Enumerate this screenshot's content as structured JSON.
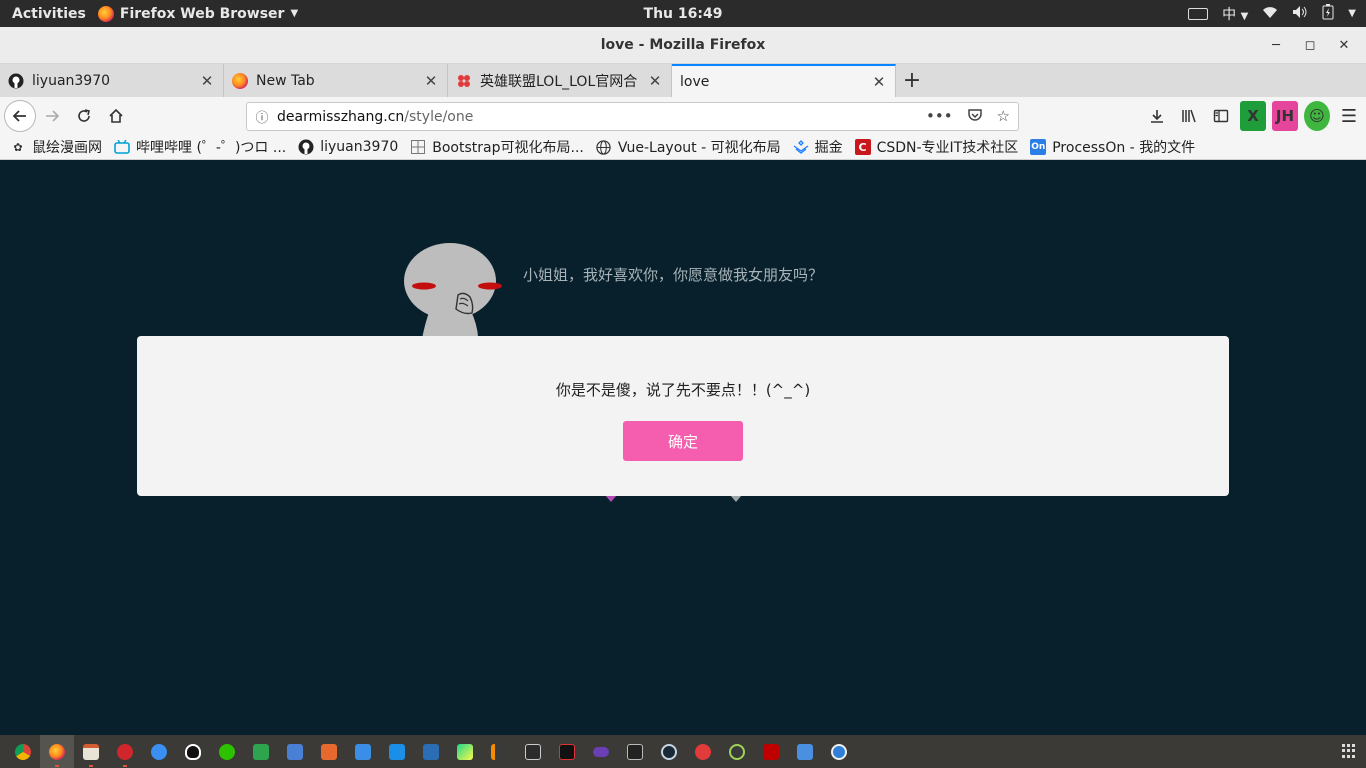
{
  "system_bar": {
    "activities": "Activities",
    "app_name": "Firefox Web Browser",
    "clock": "Thu 16:49",
    "input_method": "中"
  },
  "window": {
    "title": "love - Mozilla Firefox"
  },
  "tabs": [
    {
      "label": "liyuan3970",
      "icon": "github-icon"
    },
    {
      "label": "New Tab",
      "icon": "firefox-icon"
    },
    {
      "label": "英雄联盟LOL_LOL官网合",
      "icon": "lol-icon"
    },
    {
      "label": "love",
      "icon": "",
      "active": true
    }
  ],
  "urlbar": {
    "host": "dearmisszhang.cn",
    "path": "/style/one"
  },
  "bookmarks": [
    {
      "label": "鼠绘漫画网",
      "icon": "ishuhui-icon"
    },
    {
      "label": "哔哩哔哩 (゜-゜)つロ ...",
      "icon": "bilibili-icon"
    },
    {
      "label": "liyuan3970",
      "icon": "github-icon"
    },
    {
      "label": "Bootstrap可视化布局...",
      "icon": "grid-icon"
    },
    {
      "label": "Vue-Layout - 可视化布局",
      "icon": "globe-icon"
    },
    {
      "label": "掘金",
      "icon": "juejin-icon"
    },
    {
      "label": "CSDN-专业IT技术社区",
      "icon": "csdn-icon"
    },
    {
      "label": "ProcessOn - 我的文件",
      "icon": "processon-icon"
    }
  ],
  "extensions": {
    "jh_label": "JH"
  },
  "page": {
    "question": "小姐姐，我好喜欢你，你愿意做我女朋友吗？",
    "background": "#07202c"
  },
  "modal": {
    "message": "你是不是傻，说了先不要点！！(^_^)",
    "confirm_label": "确定",
    "button_color": "#f55eae"
  },
  "taskbar": {
    "apps": [
      "chrome-icon",
      "firefox-icon",
      "files-icon",
      "netease-music-icon",
      "cloud-icon",
      "qq-icon",
      "wechat-icon",
      "sheets-icon",
      "writer-icon",
      "presentation-icon",
      "baidu-netdisk-icon",
      "xunlei-icon",
      "vscode-icon",
      "pycharm-icon",
      "sublime-icon",
      "terminal-icon",
      "ssh-icon",
      "vr-icon",
      "console-icon",
      "steam-icon",
      "close-circle-icon",
      "idea-icon",
      "filezilla-icon",
      "tasks-icon",
      "update-icon"
    ]
  }
}
